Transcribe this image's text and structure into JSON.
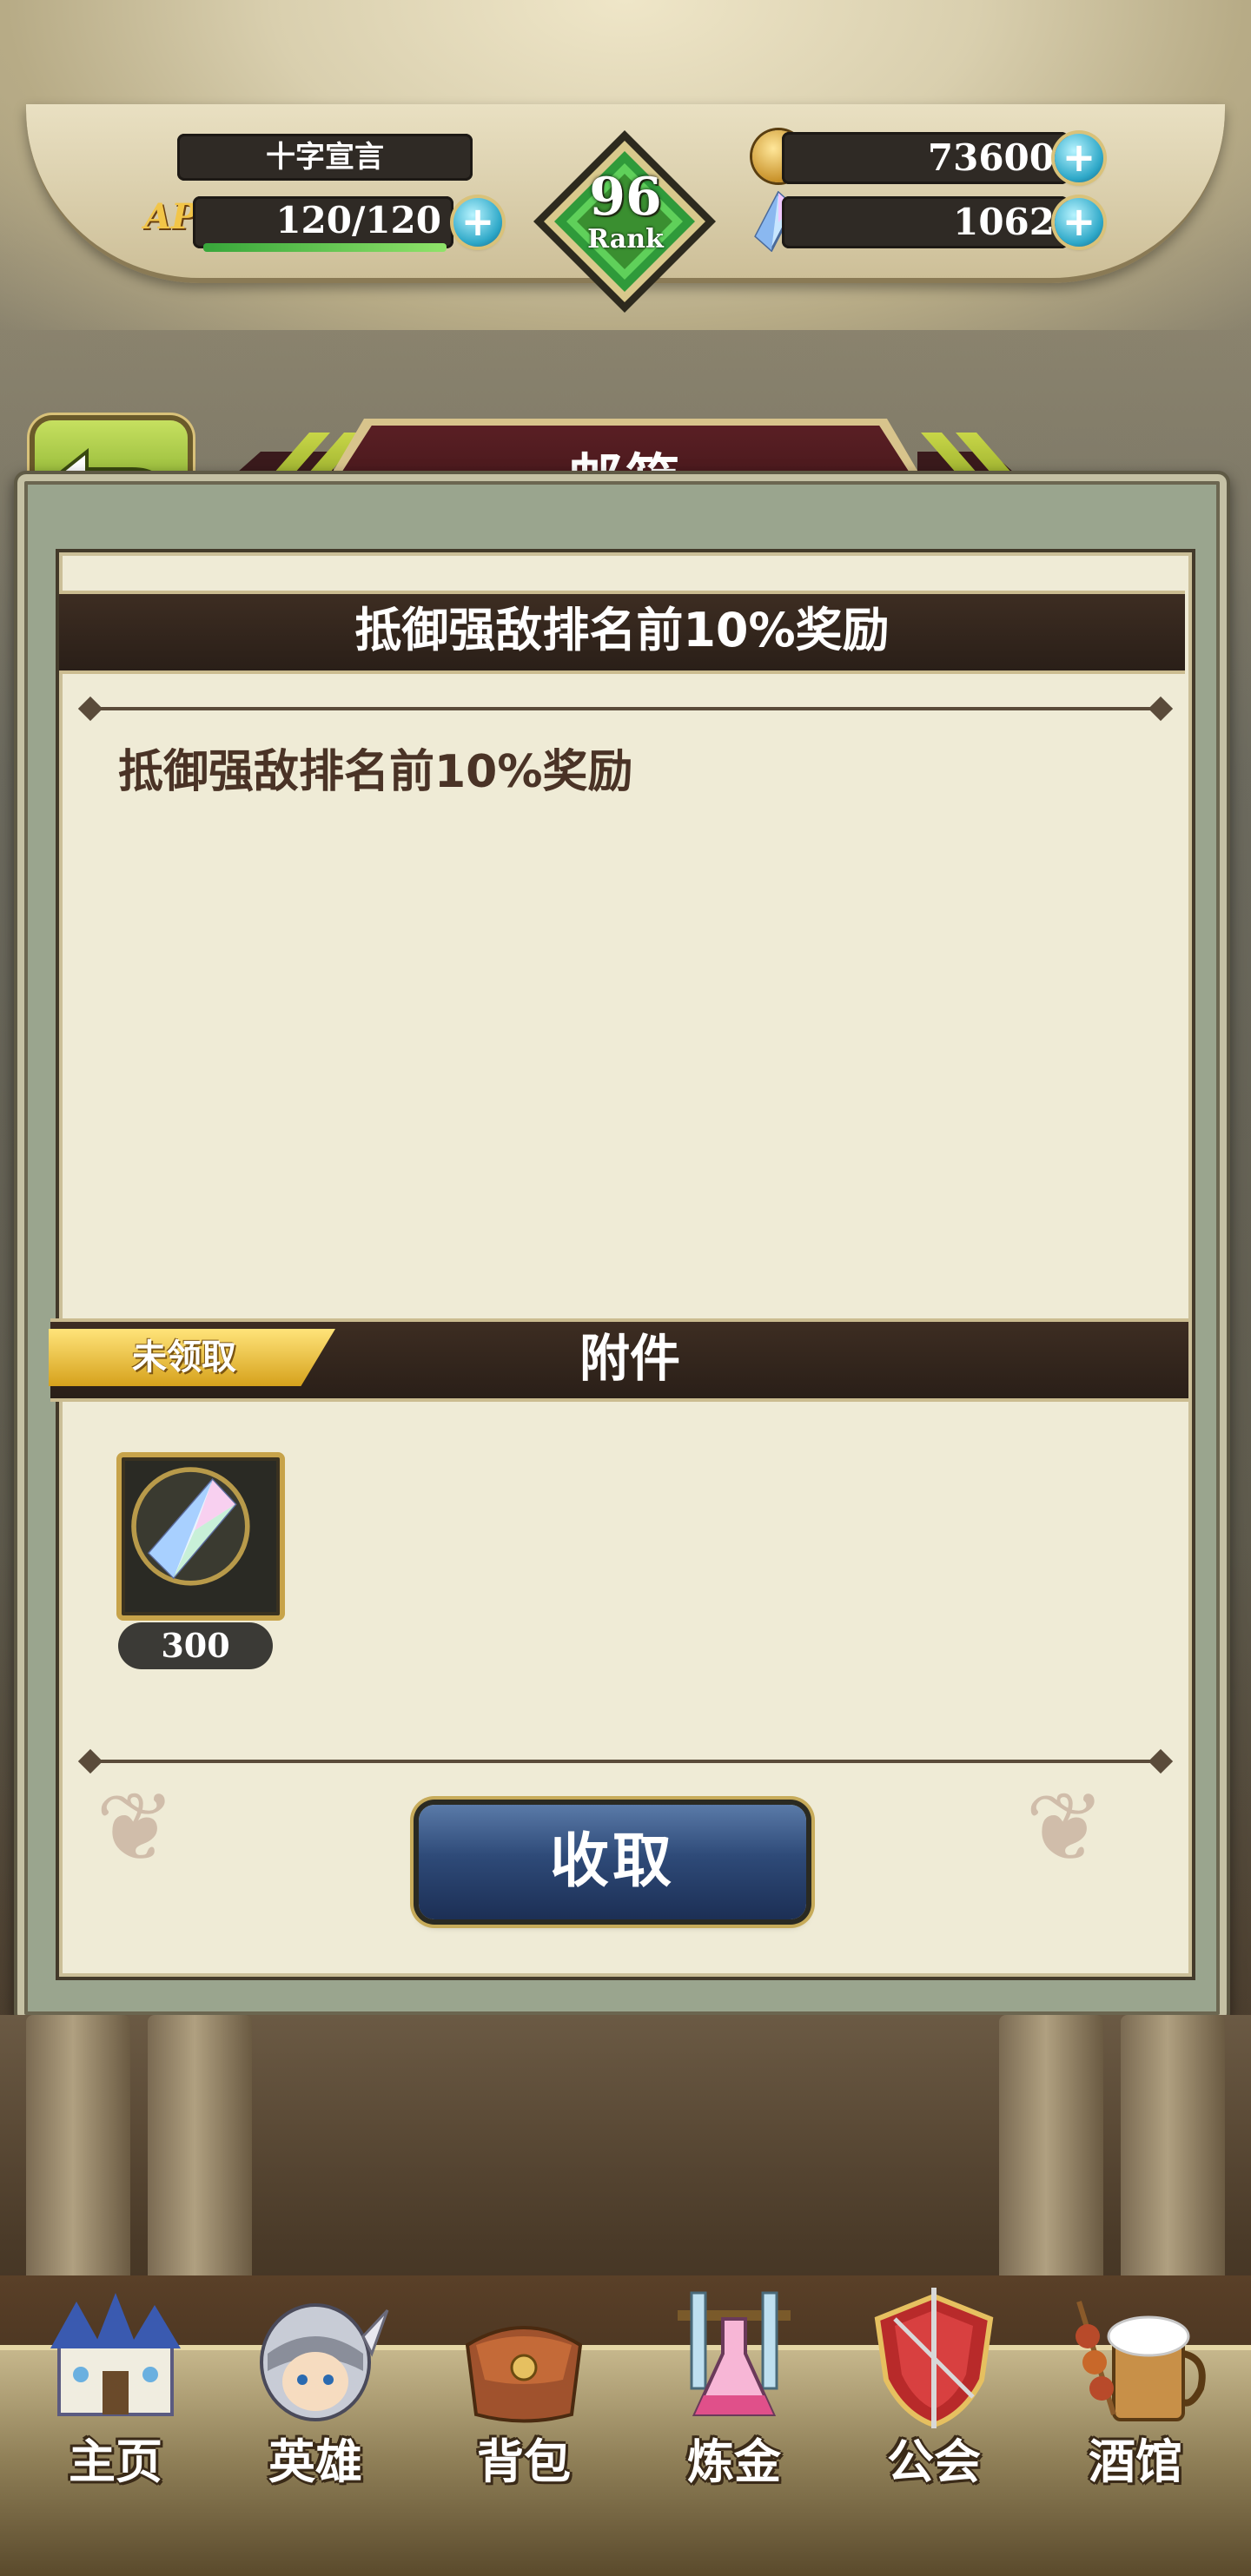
{
  "header": {
    "player_name": "十字宣言",
    "ap_label": "AP",
    "ap_value": "120/120",
    "ap_fraction": 1.0,
    "rank_number": "96",
    "rank_label": "Rank",
    "gold_value": "73600",
    "gem_value": "1062",
    "plus_symbol": "+"
  },
  "title_bar": {
    "title": "邮箱",
    "back_icon": "return-arrow-icon"
  },
  "mail": {
    "subject": "抵御强敌排名前10%奖励",
    "body": "抵御强敌排名前10%奖励",
    "attachments_label": "附件",
    "status": "未领取",
    "items": [
      {
        "icon": "crystal-gem-icon",
        "count": "300"
      }
    ],
    "collect_button": "收取"
  },
  "nav": {
    "items": [
      {
        "label": "主页",
        "icon": "castle-icon"
      },
      {
        "label": "英雄",
        "icon": "knight-helmet-icon"
      },
      {
        "label": "背包",
        "icon": "satchel-icon"
      },
      {
        "label": "炼金",
        "icon": "potion-flask-icon"
      },
      {
        "label": "公会",
        "icon": "guild-shield-icon"
      },
      {
        "label": "酒馆",
        "icon": "tavern-beer-icon"
      }
    ]
  },
  "colors": {
    "accent_green": "#6e9a18",
    "banner_red": "#5a1f24",
    "button_blue": "#2e4a78",
    "status_gold": "#d6a21c",
    "panel_bg": "#efebd6"
  }
}
